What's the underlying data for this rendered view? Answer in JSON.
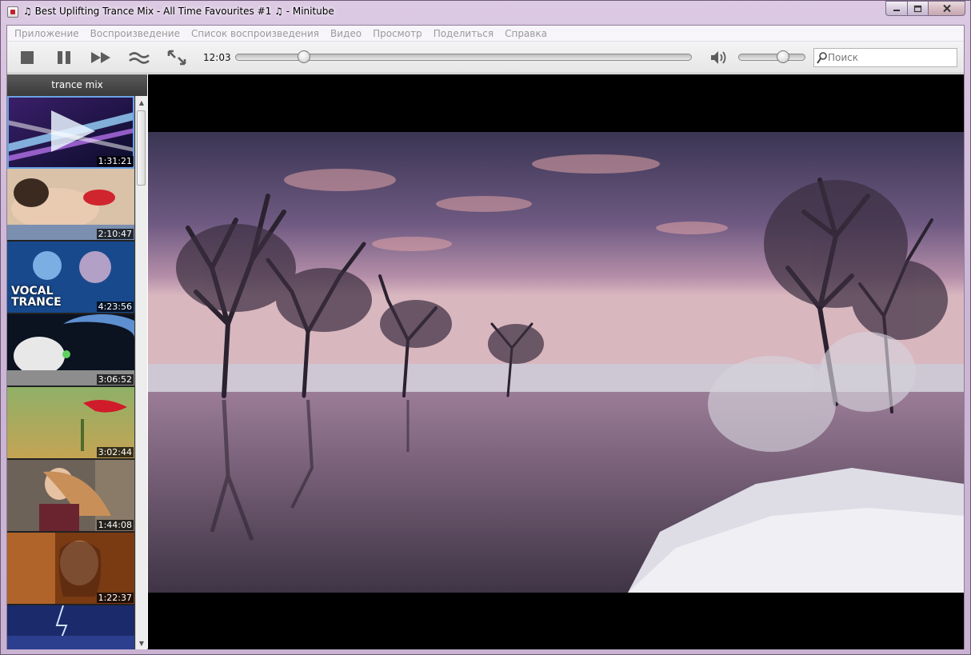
{
  "window": {
    "title": "♫ Best Uplifting Trance Mix - All Time Favourites #1 ♫ - Minitube",
    "buttons": {
      "minimize": "—",
      "maximize": "▭",
      "close": "✕"
    }
  },
  "menu": [
    {
      "label": "Приложение"
    },
    {
      "label": "Воспроизведение"
    },
    {
      "label": "Список воспроизведения"
    },
    {
      "label": "Видео"
    },
    {
      "label": "Просмотр"
    },
    {
      "label": "Поделиться"
    },
    {
      "label": "Справка"
    }
  ],
  "toolbar": {
    "stop_icon": "stop-icon",
    "pause_icon": "pause-icon",
    "skip_icon": "skip-forward-icon",
    "definition_icon": "definition-waves-icon",
    "fullscreen_icon": "fullscreen-icon",
    "elapsed_time": "12:03",
    "seek_progress": 0.14,
    "volume_icon": "speaker-icon",
    "volume_level": 0.7,
    "search_placeholder": "Поиск"
  },
  "playlist": {
    "title": "trance mix",
    "items": [
      {
        "duration": "1:31:21",
        "overlay": "",
        "active": true
      },
      {
        "duration": "2:10:47",
        "overlay": ""
      },
      {
        "duration": "4:23:56",
        "overlay": "VOCAL\nTRANCE"
      },
      {
        "duration": "3:06:52",
        "overlay": ""
      },
      {
        "duration": "3:02:44",
        "overlay": ""
      },
      {
        "duration": "1:44:08",
        "overlay": ""
      },
      {
        "duration": "1:22:37",
        "overlay": ""
      },
      {
        "duration": "",
        "overlay": ""
      }
    ]
  },
  "colors": {
    "frame": "#cdb6d6",
    "accent_selection": "#6aa3e6",
    "video_background": "#000000"
  }
}
